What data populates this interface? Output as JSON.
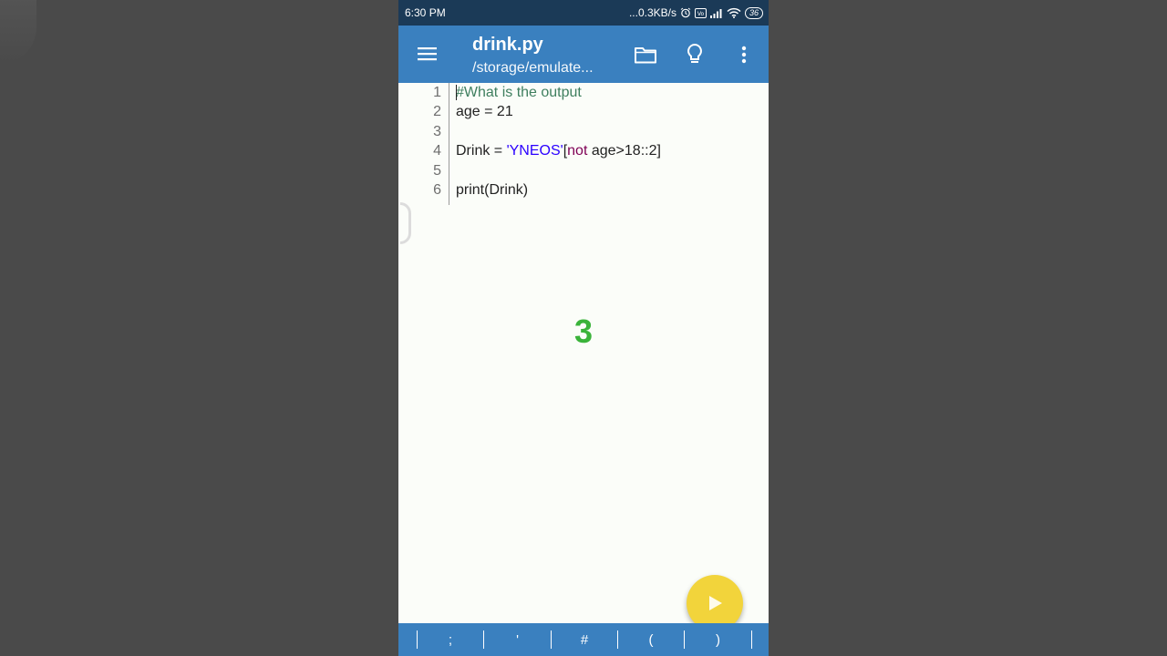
{
  "status_bar": {
    "time": "6:30 PM",
    "network_speed": "...0.3KB/s",
    "battery": "36"
  },
  "app_bar": {
    "file_name": "drink.py",
    "file_path": "/storage/emulate..."
  },
  "editor": {
    "lines": [
      {
        "num": "1",
        "parts": [
          {
            "t": "#What is the output",
            "k": "comment"
          }
        ]
      },
      {
        "num": "2",
        "parts": [
          {
            "t": "age = 21",
            "k": "plain"
          }
        ]
      },
      {
        "num": "3",
        "parts": []
      },
      {
        "num": "4",
        "parts": [
          {
            "t": "Drink = ",
            "k": "plain"
          },
          {
            "t": "'YNEOS'",
            "k": "string"
          },
          {
            "t": "[",
            "k": "plain"
          },
          {
            "t": "not",
            "k": "keyword"
          },
          {
            "t": " age>18::2]",
            "k": "plain"
          }
        ]
      },
      {
        "num": "5",
        "parts": []
      },
      {
        "num": "6",
        "parts": [
          {
            "t": "print(Drink)",
            "k": "plain"
          }
        ]
      }
    ]
  },
  "overlay": {
    "countdown": "3"
  },
  "symbol_bar": {
    "keys": [
      ";",
      "'",
      "#",
      "(",
      ")"
    ]
  },
  "colors": {
    "status_bar": "#1b3a57",
    "app_bar": "#3a80bf",
    "fab": "#f2d43b",
    "countdown": "#3ab33a"
  },
  "icons": {
    "menu": "hamburger-icon",
    "folder": "folder-icon",
    "tips": "lightbulb-icon",
    "more": "more-vert-icon",
    "run": "play-icon"
  }
}
